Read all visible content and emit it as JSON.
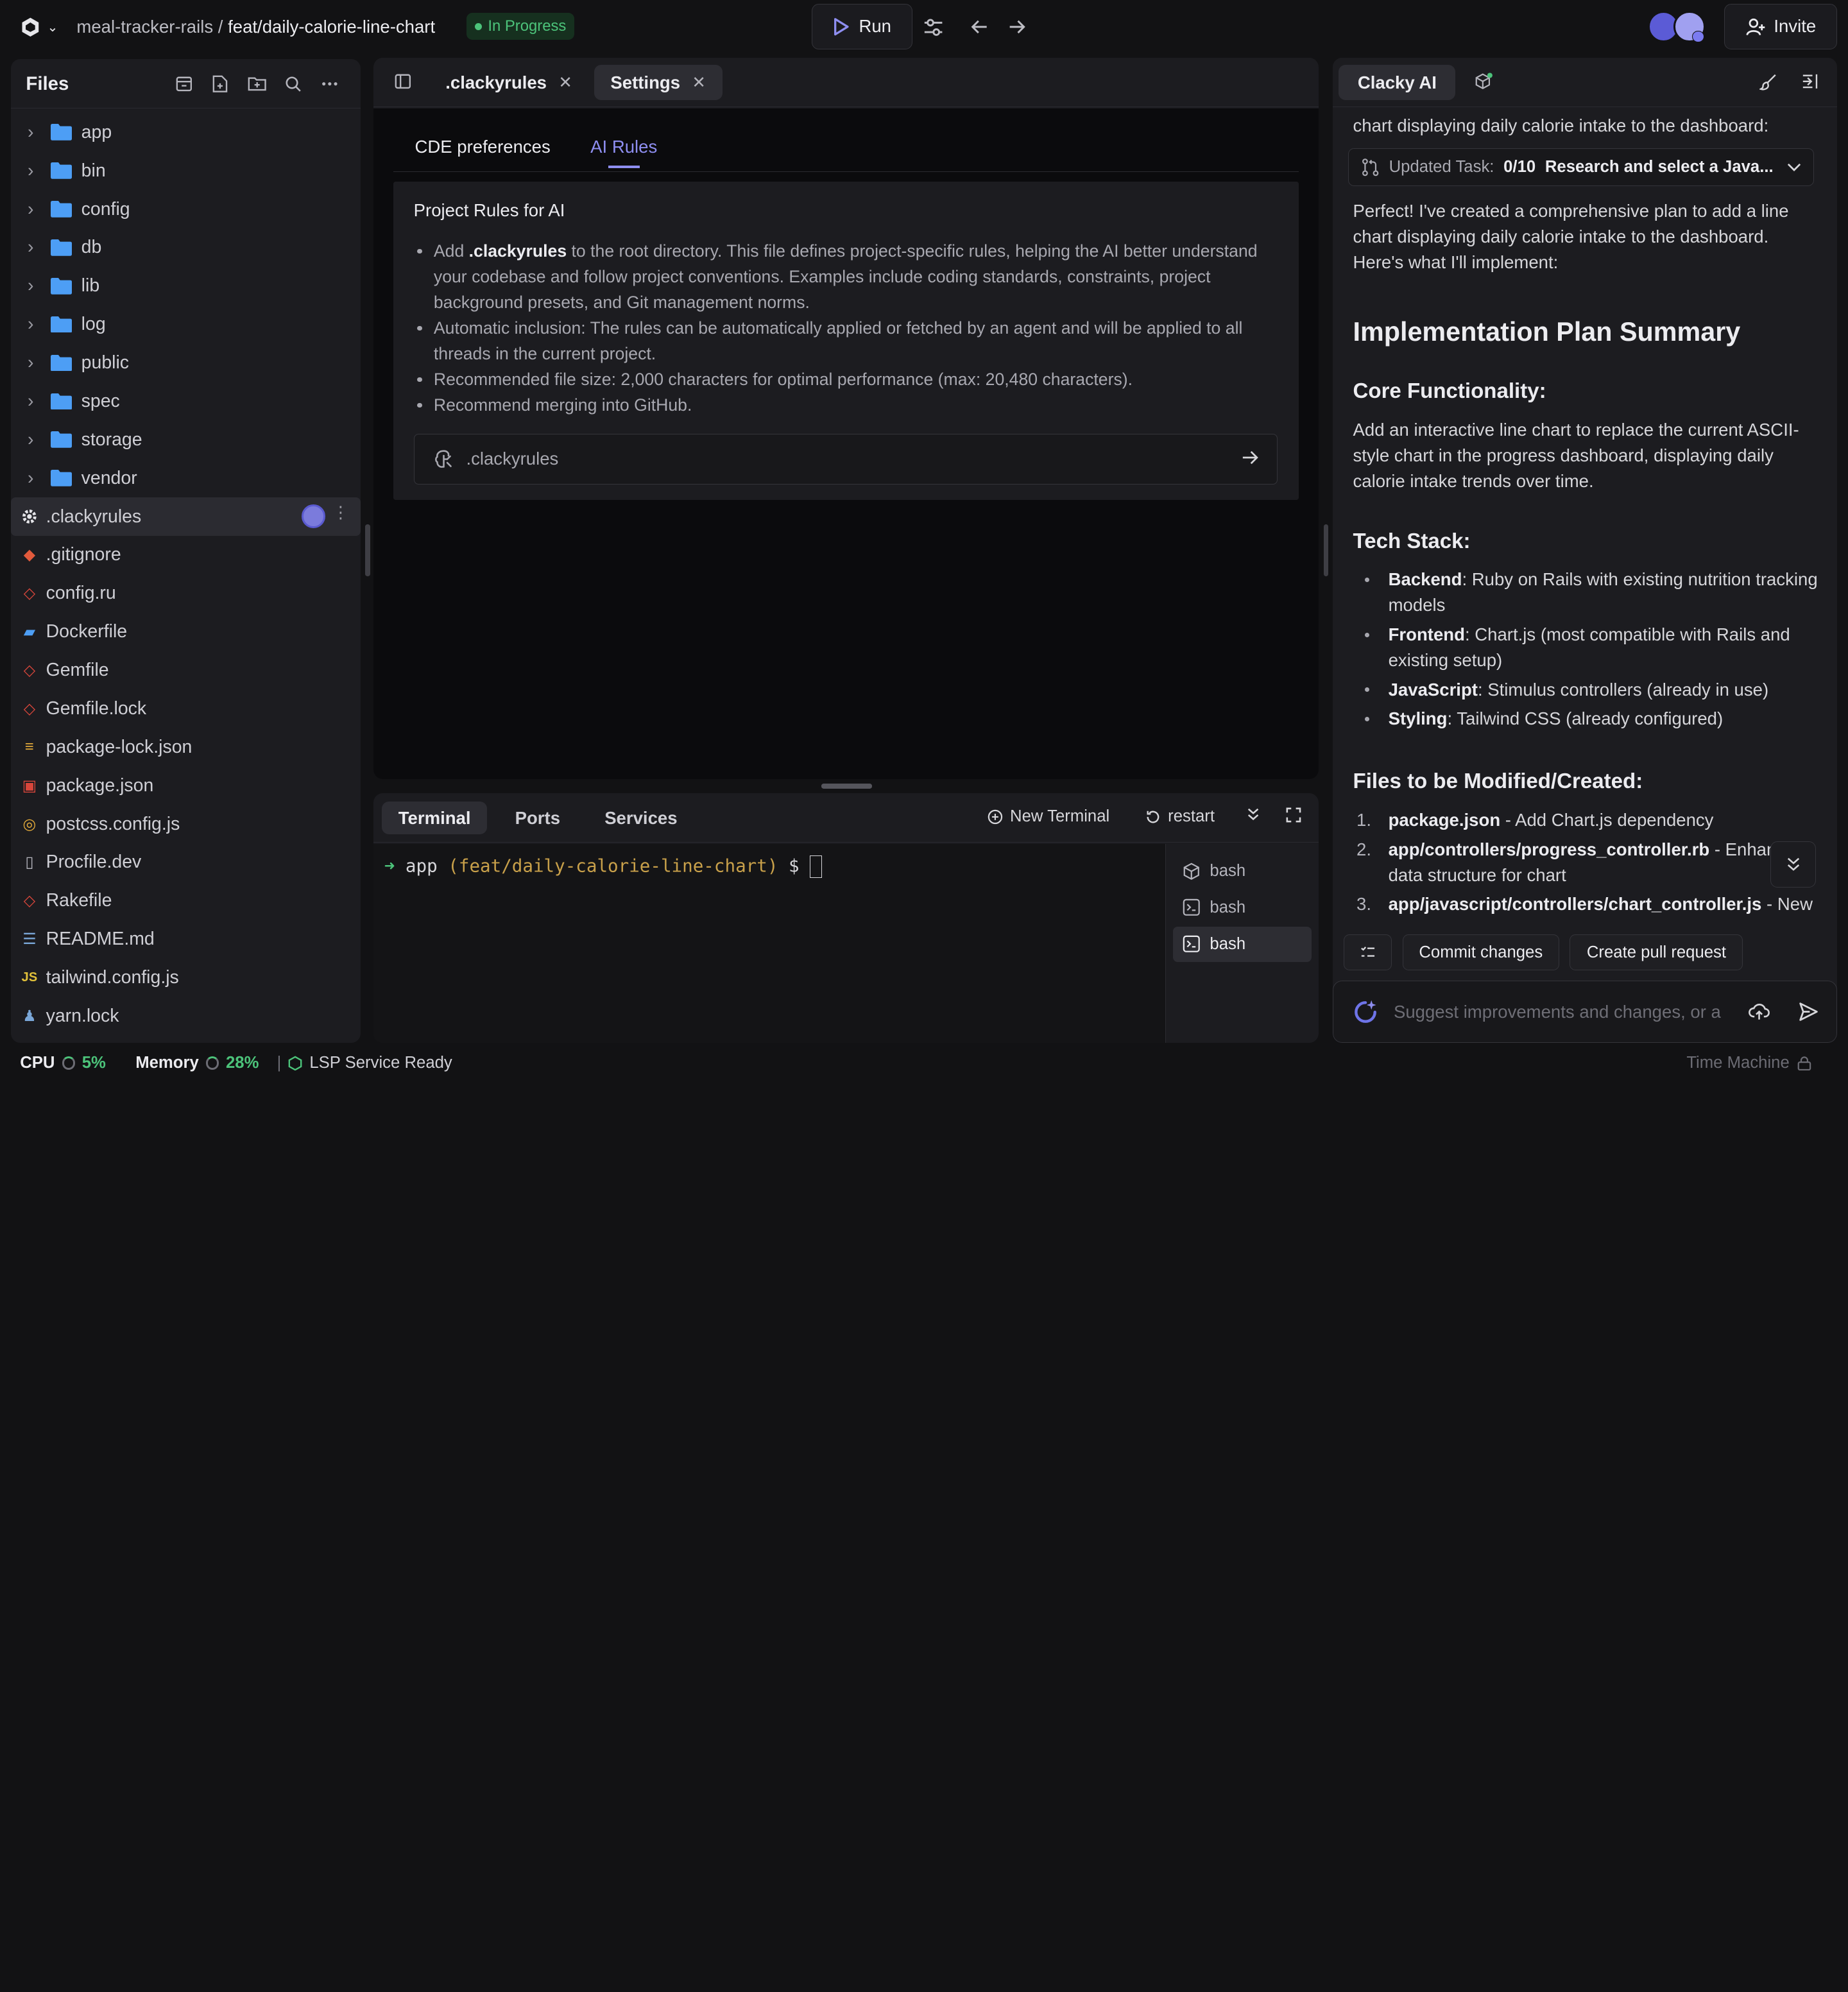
{
  "topbar": {
    "repo": "meal-tracker-rails",
    "separator": "/",
    "branch": "feat/daily-calorie-line-chart",
    "status": "In Progress",
    "run_label": "Run",
    "invite_label": "Invite"
  },
  "files": {
    "title": "Files",
    "items": [
      {
        "name": "app",
        "type": "folder"
      },
      {
        "name": "bin",
        "type": "folder"
      },
      {
        "name": "config",
        "type": "folder"
      },
      {
        "name": "db",
        "type": "folder"
      },
      {
        "name": "lib",
        "type": "folder"
      },
      {
        "name": "log",
        "type": "folder"
      },
      {
        "name": "public",
        "type": "folder"
      },
      {
        "name": "spec",
        "type": "folder"
      },
      {
        "name": "storage",
        "type": "folder"
      },
      {
        "name": "vendor",
        "type": "folder"
      },
      {
        "name": ".clackyrules",
        "type": "file",
        "icon": "gear-icon",
        "selected": true
      },
      {
        "name": ".gitignore",
        "type": "file",
        "icon": "git-icon"
      },
      {
        "name": "config.ru",
        "type": "file",
        "icon": "ruby-icon"
      },
      {
        "name": "Dockerfile",
        "type": "file",
        "icon": "docker-icon"
      },
      {
        "name": "Gemfile",
        "type": "file",
        "icon": "ruby-icon"
      },
      {
        "name": "Gemfile.lock",
        "type": "file",
        "icon": "ruby-icon"
      },
      {
        "name": "package-lock.json",
        "type": "file",
        "icon": "npm-lock-icon"
      },
      {
        "name": "package.json",
        "type": "file",
        "icon": "npm-icon"
      },
      {
        "name": "postcss.config.js",
        "type": "file",
        "icon": "postcss-icon"
      },
      {
        "name": "Procfile.dev",
        "type": "file",
        "icon": "file-icon"
      },
      {
        "name": "Rakefile",
        "type": "file",
        "icon": "ruby-icon"
      },
      {
        "name": "README.md",
        "type": "file",
        "icon": "markdown-icon"
      },
      {
        "name": "tailwind.config.js",
        "type": "file",
        "icon": "js-icon"
      },
      {
        "name": "yarn.lock",
        "type": "file",
        "icon": "yarn-icon"
      }
    ]
  },
  "editor": {
    "tabs": [
      {
        "label": ".clackyrules"
      },
      {
        "label": "Settings"
      }
    ],
    "subtabs": [
      "CDE preferences",
      "AI Rules"
    ],
    "rules_title": "Project Rules for AI",
    "rules": [
      {
        "pre": "Add ",
        "bold": ".clackyrules",
        "post": " to the root directory. This file defines project-specific rules, helping the AI better understand your codebase and follow project conventions. Examples include coding standards, constraints, project background presets, and Git management norms."
      },
      {
        "pre": "Automatic inclusion: The rules can be automatically applied or fetched by an agent and will be applied to all threads in the current project.",
        "bold": "",
        "post": ""
      },
      {
        "pre": "Recommended file size: 2,000 characters for optimal performance (max: 20,480 characters).",
        "bold": "",
        "post": ""
      },
      {
        "pre": "Recommend merging into GitHub.",
        "bold": "",
        "post": ""
      }
    ],
    "file_link": ".clackyrules"
  },
  "terminal": {
    "tabs": [
      "Terminal",
      "Ports",
      "Services"
    ],
    "new_terminal": "New Terminal",
    "restart": "restart",
    "prompt_arrow": "➜",
    "prompt_dir": "app",
    "prompt_branch": "(feat/daily-calorie-line-chart)",
    "prompt_symbol": "$",
    "sessions": [
      "bash",
      "bash",
      "bash"
    ]
  },
  "ai": {
    "tab": "Clacky AI",
    "intro_tail": "chart displaying daily calorie intake to the dashboard:",
    "task_label": "Updated Task:",
    "task_count": "0/10",
    "task_title": "Research and select a Java...",
    "message": "Perfect! I've created a comprehensive plan to add a line chart displaying daily calorie intake to the dashboard. Here's what I'll implement:",
    "h_plan": "Implementation Plan Summary",
    "h_core": "Core Functionality:",
    "core_text": "Add an interactive line chart to replace the current ASCII-style chart in the progress dashboard, displaying daily calorie intake trends over time.",
    "h_stack": "Tech Stack:",
    "stack": [
      {
        "b": "Backend",
        "t": ": Ruby on Rails with existing nutrition tracking models"
      },
      {
        "b": "Frontend",
        "t": ": Chart.js (most compatible with Rails and existing setup)"
      },
      {
        "b": "JavaScript",
        "t": ": Stimulus controllers (already in use)"
      },
      {
        "b": "Styling",
        "t": ": Tailwind CSS (already configured)"
      }
    ],
    "h_files": "Files to be Modified/Created:",
    "files": [
      {
        "n": "1.",
        "b": "package.json",
        "t": " - Add Chart.js dependency"
      },
      {
        "n": "2.",
        "b": "app/controllers/progress_controller.rb",
        "t": " - Enhance data structure for chart"
      },
      {
        "n": "3.",
        "b": "app/javascript/controllers/chart_controller.js",
        "t": " - New"
      }
    ],
    "commit_label": "Commit changes",
    "pr_label": "Create pull request",
    "input_placeholder": "Suggest improvements and changes, or a"
  },
  "statusbar": {
    "cpu_label": "CPU",
    "cpu_val": "5%",
    "mem_label": "Memory",
    "mem_val": "28%",
    "lsp": "LSP Service Ready",
    "time_machine": "Time Machine"
  },
  "colors": {
    "accent": "#8e8ef0",
    "success": "#4cc37a",
    "folder": "#4d9ef5"
  }
}
